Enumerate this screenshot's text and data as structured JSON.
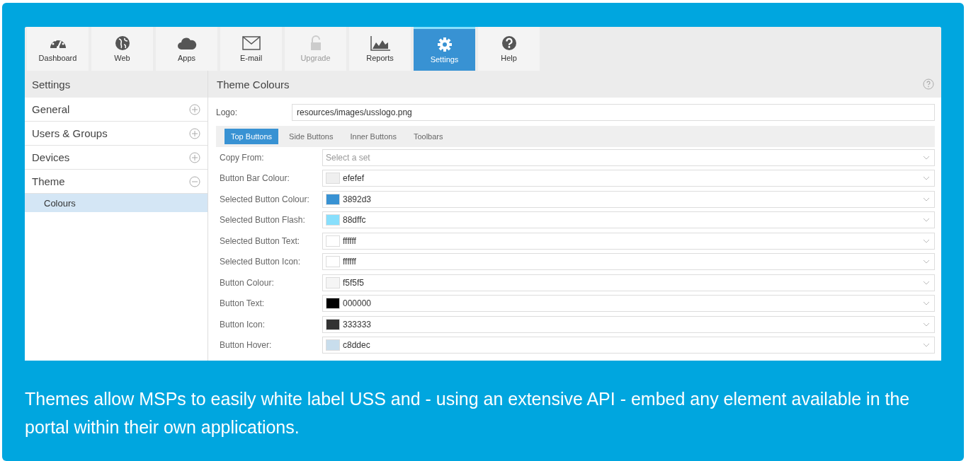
{
  "toolbar": {
    "tabs": [
      {
        "label": "Dashboard",
        "selected": false,
        "disabled": false
      },
      {
        "label": "Web",
        "selected": false,
        "disabled": false
      },
      {
        "label": "Apps",
        "selected": false,
        "disabled": false
      },
      {
        "label": "E-mail",
        "selected": false,
        "disabled": false
      },
      {
        "label": "Upgrade",
        "selected": false,
        "disabled": true
      },
      {
        "label": "Reports",
        "selected": false,
        "disabled": false
      },
      {
        "label": "Settings",
        "selected": true,
        "disabled": false
      },
      {
        "label": "Help",
        "selected": false,
        "disabled": false
      }
    ]
  },
  "sidebar": {
    "title": "Settings",
    "items": [
      {
        "label": "General",
        "expanded": false,
        "selected": false
      },
      {
        "label": "Users & Groups",
        "expanded": false,
        "selected": false
      },
      {
        "label": "Devices",
        "expanded": false,
        "selected": false
      },
      {
        "label": "Theme",
        "expanded": true,
        "selected": false,
        "children": [
          {
            "label": "Colours",
            "selected": true
          }
        ]
      }
    ]
  },
  "panel": {
    "title": "Theme Colours",
    "logo": {
      "label": "Logo:",
      "value": "resources/images/usslogo.png"
    },
    "subtabs": [
      {
        "label": "Top Buttons",
        "selected": true
      },
      {
        "label": "Side Buttons",
        "selected": false
      },
      {
        "label": "Inner Buttons",
        "selected": false
      },
      {
        "label": "Toolbars",
        "selected": false
      }
    ],
    "rows": [
      {
        "kind": "select",
        "label": "Copy From:",
        "placeholder": "Select a set"
      },
      {
        "kind": "colour",
        "label": "Button Bar Colour:",
        "value": "efefef",
        "color": "#efefef"
      },
      {
        "kind": "colour",
        "label": "Selected Button Colour:",
        "value": "3892d3",
        "color": "#3892d3"
      },
      {
        "kind": "colour",
        "label": "Selected Button Flash:",
        "value": "88dffc",
        "color": "#88dffc"
      },
      {
        "kind": "colour",
        "label": "Selected Button Text:",
        "value": "ffffff",
        "color": "#ffffff"
      },
      {
        "kind": "colour",
        "label": "Selected Button Icon:",
        "value": "ffffff",
        "color": "#ffffff"
      },
      {
        "kind": "colour",
        "label": "Button Colour:",
        "value": "f5f5f5",
        "color": "#f5f5f5"
      },
      {
        "kind": "colour",
        "label": "Button Text:",
        "value": "000000",
        "color": "#000000"
      },
      {
        "kind": "colour",
        "label": "Button Icon:",
        "value": "333333",
        "color": "#333333"
      },
      {
        "kind": "colour",
        "label": "Button Hover:",
        "value": "c8ddec",
        "color": "#c8ddec"
      }
    ]
  },
  "caption": "Themes allow MSPs to easily white label USS and - using an extensive API - embed any element available in the portal within their own applications."
}
